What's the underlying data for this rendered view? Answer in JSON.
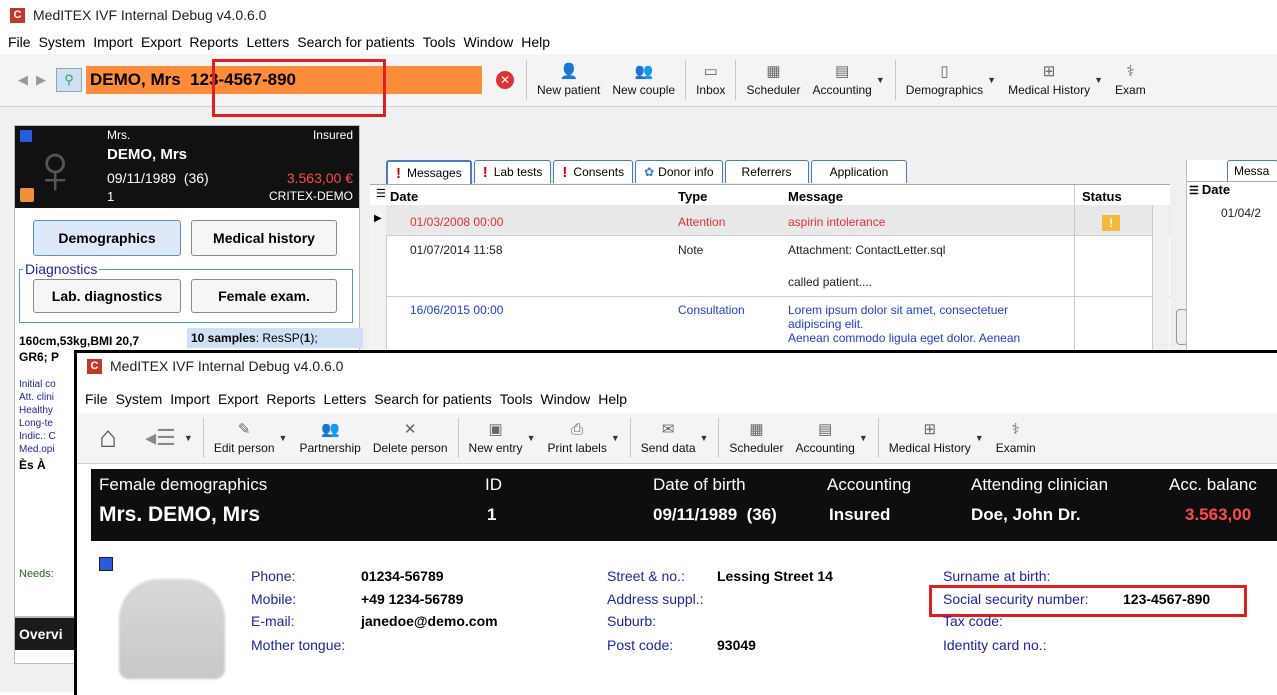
{
  "back": {
    "title": "MedITEX IVF Internal Debug v4.0.6.0",
    "menu": [
      "File",
      "System",
      "Import",
      "Export",
      "Reports",
      "Letters",
      "Search for patients",
      "Tools",
      "Window",
      "Help"
    ],
    "search_value": "DEMO, Mrs  123-4567-890",
    "toolbar": [
      "New patient",
      "New couple",
      "Inbox",
      "Scheduler",
      "Accounting",
      "Demographics",
      "Medical History",
      "Exam"
    ],
    "card": {
      "salutation": "Mrs.",
      "status": "Insured",
      "name": "DEMO, Mrs",
      "dob": "09/11/1989",
      "age": "(36)",
      "balance": "3.563,00 €",
      "id": "1",
      "clinic": "CRITEX-DEMO",
      "btn_demographics": "Demographics",
      "btn_medical": "Medical history",
      "diagnostics_label": "Diagnostics",
      "btn_lab": "Lab. diagnostics",
      "btn_female": "Female exam.",
      "vitals_1": "160cm,53kg,",
      "vitals_bmi": "BMI 20,7",
      "vitals_2": "GR6; P",
      "samples_bold": "10 samples",
      "samples_rest": ": ResSP(",
      "samples_num": "1",
      "samples_end": ");",
      "side_lines": [
        "Initial co",
        "Att. clini",
        "Healthy",
        "Long-te",
        "Indic.: C",
        "Med.opi"
      ],
      "es_a": "Ès À",
      "needs": "Needs:",
      "overview": "Overvi"
    },
    "tabs": [
      "Messages",
      "Lab tests",
      "Consents",
      "Donor info",
      "Referrers",
      "Application"
    ],
    "grid": {
      "headers": [
        "Date",
        "Type",
        "Message",
        "Status"
      ],
      "rows": [
        {
          "date": "01/03/2008 00:00",
          "type": "Attention",
          "message": "aspirin intolerance"
        },
        {
          "date": "01/07/2014 11:58",
          "type": "Note",
          "message": "Attachment: ContactLetter.sql",
          "message2": "called patient...."
        },
        {
          "date": "16/06/2015 00:00",
          "type": "Consultation",
          "message": "Lorem ipsum dolor sit amet, consectetuer",
          "message2": "adipiscing elit.",
          "message3": "Aenean commodo ligula eget dolor. Aenean"
        }
      ]
    },
    "right_panel": {
      "tab": "Messa",
      "header": "Date",
      "date": "01/04/2"
    }
  },
  "front": {
    "title": "MedITEX IVF Internal Debug v4.0.6.0",
    "menu": [
      "File",
      "System",
      "Import",
      "Export",
      "Reports",
      "Letters",
      "Search for patients",
      "Tools",
      "Window",
      "Help"
    ],
    "toolbar": [
      "Edit person",
      "Partnership",
      "Delete person",
      "New entry",
      "Print labels",
      "Send data",
      "Scheduler",
      "Accounting",
      "Medical History",
      "Examin"
    ],
    "header": {
      "section": "Female demographics",
      "name": "Mrs. DEMO, Mrs",
      "id_label": "ID",
      "id_value": "1",
      "dob_label": "Date of birth",
      "dob_value": "09/11/1989",
      "age": "(36)",
      "acc_label": "Accounting",
      "acc_value": "Insured",
      "clin_label": "Attending clinician",
      "clin_value": "Doe, John Dr.",
      "bal_label": "Acc. balanc",
      "bal_value": "3.563,00"
    },
    "contact": {
      "phone_label": "Phone:",
      "phone": "01234-56789",
      "mobile_label": "Mobile:",
      "mobile": "+49 1234-56789",
      "email_label": "E-mail:",
      "email": "janedoe@demo.com",
      "tongue_label": "Mother tongue:",
      "street_label": "Street & no.:",
      "street": "Lessing Street 14",
      "addr_label": "Address suppl.:",
      "suburb_label": "Suburb:",
      "post_label": "Post code:",
      "post": "93049",
      "birth_label": "Surname at birth:",
      "ssn_label": "Social security number:",
      "ssn": "123-4567-890",
      "tax_label": "Tax code:",
      "idcard_label": "Identity card no.:"
    }
  },
  "colors": {
    "accent_orange": "#ff8c3a",
    "highlight_red": "#e02020",
    "link_blue": "#1e24a0",
    "alert_red": "#e03030"
  }
}
